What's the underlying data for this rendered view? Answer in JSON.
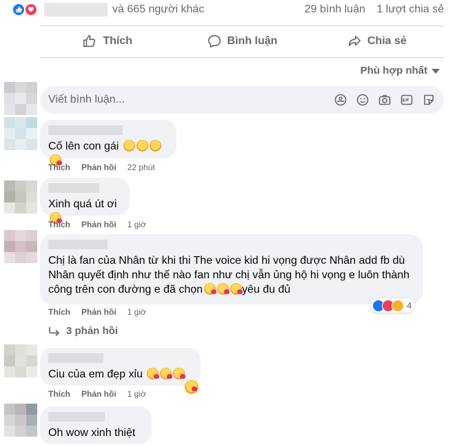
{
  "summary": {
    "others_text": "và 665 người khác",
    "comments_count": "29 bình luận",
    "shares_count": "1 lượt chia sẻ"
  },
  "actions": {
    "like": "Thích",
    "comment": "Bình luận",
    "share": "Chia sẻ"
  },
  "sort": {
    "label": "Phù hợp nhất"
  },
  "composer": {
    "placeholder": "Viết bình luận..."
  },
  "comments": [
    {
      "text": "Cố lên con gái",
      "like": "Thích",
      "reply": "Phản hồi",
      "time": "22 phút"
    },
    {
      "text": "Xinh quá út ơi",
      "like": "Thích",
      "reply": "Phản hồi",
      "time": "1 giờ"
    },
    {
      "text": "Chị là fan của Nhân từ khi thi The voice kid hi vọng được Nhân add fb dù Nhân quyết định như thế nào fan như chị vẫn ủng hộ hi vọng e luôn thành công trên con đường e đã chọn",
      "text_tail": "yêu đu đủ",
      "like": "Thích",
      "reply": "Phản hồi",
      "time": "1 giờ",
      "reaction_count": "4",
      "replies_label": "3 phản hồi"
    },
    {
      "text": "Ciu của em đẹp xỉu",
      "like": "Thích",
      "reply": "Phản hồi",
      "time": "1 giờ"
    },
    {
      "text": "Oh wow xinh thiệt"
    }
  ],
  "colors": {
    "accent": "#1877f2",
    "love": "#f33e58",
    "muted": "#65676b",
    "bubble": "#f0f2f5"
  }
}
